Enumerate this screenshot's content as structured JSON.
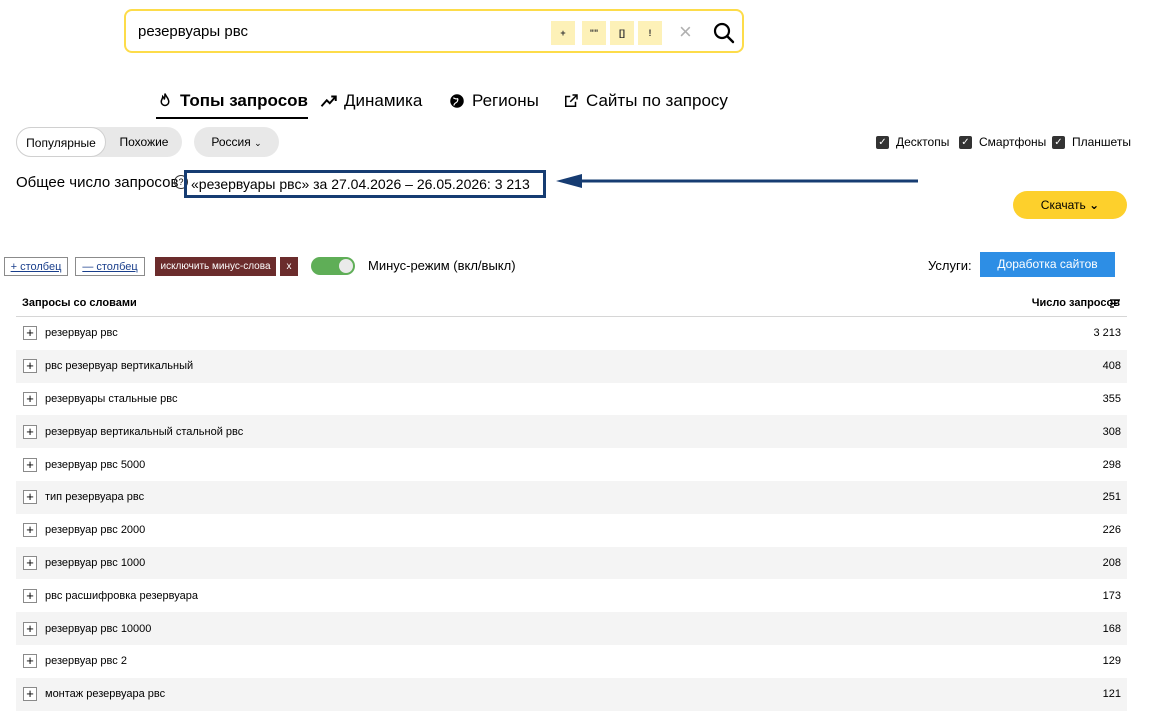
{
  "search": {
    "query": "резервуары рвс",
    "operators": [
      "+",
      "\"\"",
      "[]",
      "!"
    ]
  },
  "tabs": [
    {
      "label": "Топы запросов",
      "icon": "fire-icon"
    },
    {
      "label": "Динамика",
      "icon": "trend-icon"
    },
    {
      "label": "Регионы",
      "icon": "globe-icon"
    },
    {
      "label": "Сайты по запросу",
      "icon": "external-link-icon"
    }
  ],
  "filters": {
    "mode_popular": "Популярные",
    "mode_similar": "Похожие",
    "region": "Россия",
    "devices": [
      "Десктопы",
      "Смартфоны",
      "Планшеты"
    ]
  },
  "summary": {
    "label": "Общее число запросов",
    "highlight": "«резервуары рвс» за 27.04.2026 – 26.05.2026: 3 213",
    "help_glyph": "?"
  },
  "actions": {
    "download": "Скачать",
    "add_column": "+ столбец",
    "remove_column": "— столбец",
    "exclude_minus": "исключить минус-слова",
    "exclude_close": "x",
    "minus_mode": "Минус-режим (вкл/выкл)",
    "services_label": "Услуги:",
    "services_button": "Доработка сайтов"
  },
  "table": {
    "col_phrase": "Запросы со словами",
    "col_count": "Число запросов",
    "rows": [
      {
        "phrase": "резервуар рвс",
        "count": "3 213"
      },
      {
        "phrase": "рвс резервуар вертикальный",
        "count": "408"
      },
      {
        "phrase": "резервуары стальные рвс",
        "count": "355"
      },
      {
        "phrase": "резервуар вертикальный стальной рвс",
        "count": "308"
      },
      {
        "phrase": "резервуар рвс 5000",
        "count": "298"
      },
      {
        "phrase": "тип резервуара рвс",
        "count": "251"
      },
      {
        "phrase": "резервуар рвс 2000",
        "count": "226"
      },
      {
        "phrase": "резервуар рвс 1000",
        "count": "208"
      },
      {
        "phrase": "рвс расшифровка резервуара",
        "count": "173"
      },
      {
        "phrase": "резервуар рвс 10000",
        "count": "168"
      },
      {
        "phrase": "резервуар рвс 2",
        "count": "129"
      },
      {
        "phrase": "монтаж резервуара рвс",
        "count": "121"
      }
    ]
  },
  "colors": {
    "accent_yellow": "#fdd02c",
    "annotation_blue": "#163c72",
    "service_blue": "#2d8ee5",
    "toggle_green": "#5fae57",
    "dark_red": "#6b2c2c"
  }
}
